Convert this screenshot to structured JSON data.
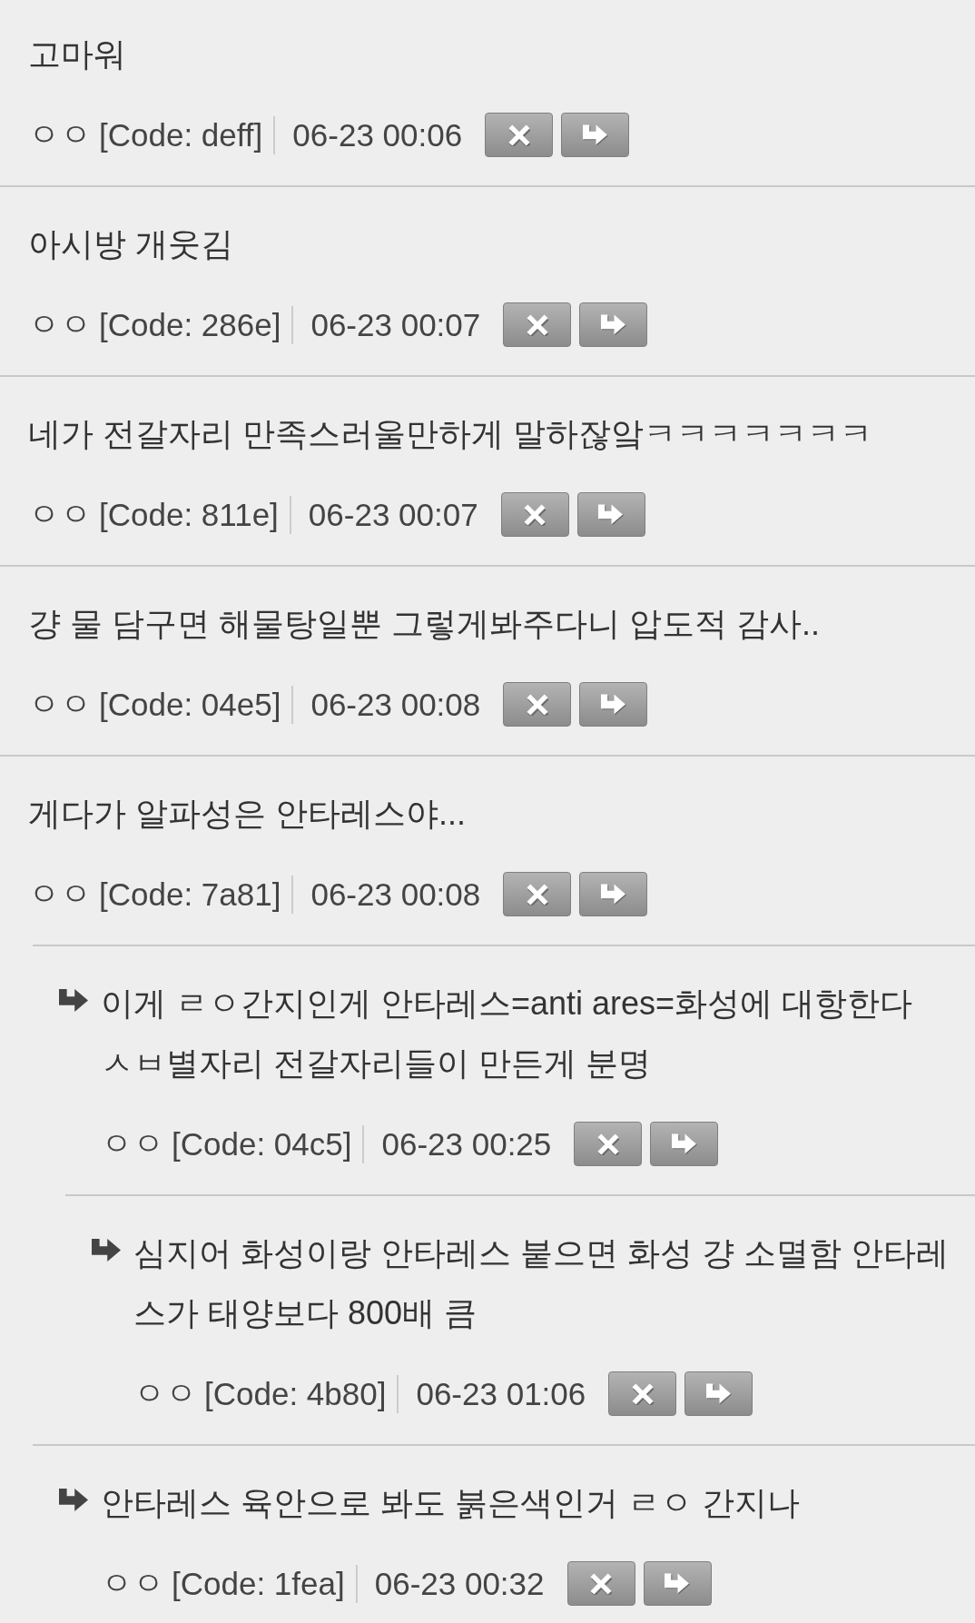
{
  "comments": [
    {
      "text": "고마워",
      "author": "ㅇㅇ",
      "code": "[Code: deff]",
      "time": "06-23 00:06"
    },
    {
      "text": "아시방 개웃김",
      "author": "ㅇㅇ",
      "code": "[Code: 286e]",
      "time": "06-23 00:07"
    },
    {
      "text": "네가 전갈자리 만족스러울만하게 말하잖앜ㅋㅋㅋㅋㅋㅋㅋ",
      "author": "ㅇㅇ",
      "code": "[Code: 811e]",
      "time": "06-23 00:07"
    },
    {
      "text": "걍 물 담구면 해물탕일뿐 그렇게봐주다니 압도적 감사..",
      "author": "ㅇㅇ",
      "code": "[Code: 04e5]",
      "time": "06-23 00:08"
    },
    {
      "text": "게다가 알파성은 안타레스야...",
      "author": "ㅇㅇ",
      "code": "[Code: 7a81]",
      "time": "06-23 00:08",
      "children": [
        {
          "text": "이게 ㄹㅇ간지인게 안타레스=anti ares=화성에 대항한다 ㅅㅂ별자리 전갈자리들이 만든게 분명",
          "author": "ㅇㅇ",
          "code": "[Code: 04c5]",
          "time": "06-23 00:25",
          "children": [
            {
              "text": "심지어 화성이랑 안타레스 붙으면 화성 걍 소멸함 안타레스가 태양보다 800배 큼",
              "author": "ㅇㅇ",
              "code": "[Code: 4b80]",
              "time": "06-23 01:06"
            }
          ]
        },
        {
          "text": "안타레스 육안으로 봐도 붉은색인거 ㄹㅇ 간지나",
          "author": "ㅇㅇ",
          "code": "[Code: 1fea]",
          "time": "06-23 00:32"
        }
      ]
    }
  ]
}
